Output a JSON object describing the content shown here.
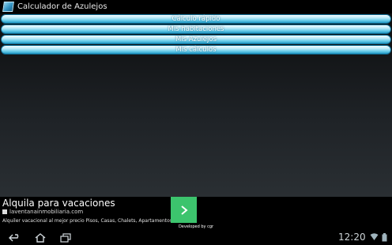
{
  "app": {
    "title": "Calculador de Azulejos"
  },
  "menu": {
    "items": [
      {
        "label": "Cálculo rápido"
      },
      {
        "label": "Mis habitaciones"
      },
      {
        "label": "Mis Azulejos"
      },
      {
        "label": "Mis cálculos"
      }
    ]
  },
  "ad": {
    "headline": "Alquila para vacaciones",
    "url": "laventanainmobiliaria.com",
    "description": "Alquiler vacacional al mejor precio Pisos, Casas, Chalets, Apartamentos",
    "arrow_icon": "chevron-right-icon",
    "accent": "#3cc46d"
  },
  "footer": {
    "text": "Developed by cgr"
  },
  "system": {
    "clock": "12:20",
    "nav_icons": [
      "back-icon",
      "home-icon",
      "recent-apps-icon"
    ],
    "status_icons": [
      "wifi-icon",
      "battery-icon"
    ]
  }
}
